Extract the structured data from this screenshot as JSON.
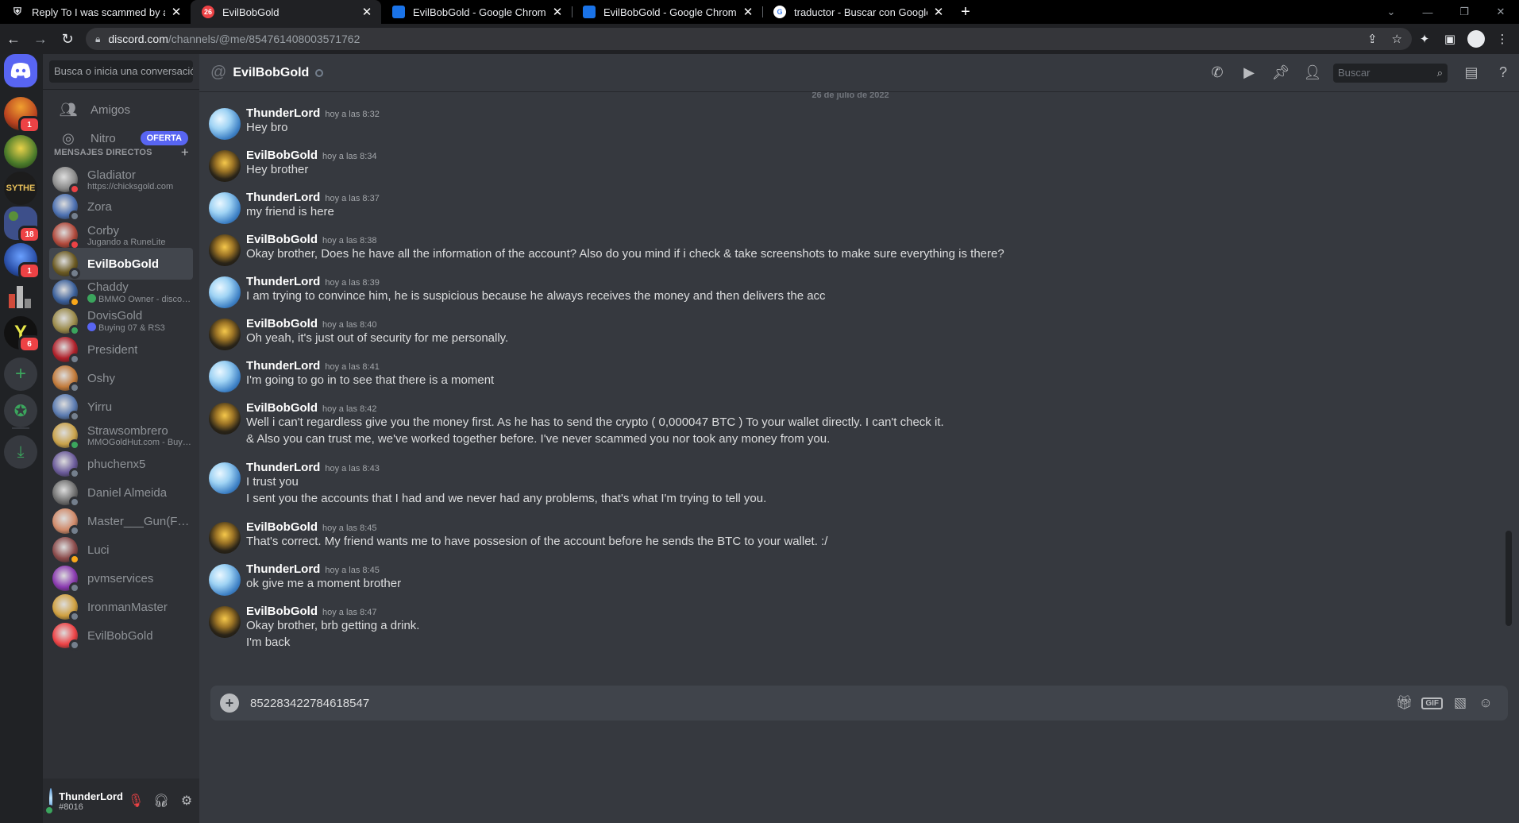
{
  "browser": {
    "tabs": [
      {
        "title": "Reply To I was scammed by a bg",
        "icon": "shield-icon",
        "active": false
      },
      {
        "title": "EvilBobGold",
        "icon": "discord-icon",
        "badge": "26",
        "active": true
      },
      {
        "title": "EvilBobGold - Google Chrome",
        "icon": "blue-app-icon",
        "active": false
      },
      {
        "title": "EvilBobGold - Google Chrome",
        "icon": "blue-app-icon",
        "active": false
      },
      {
        "title": "traductor - Buscar con Google",
        "icon": "google-icon",
        "active": false
      }
    ],
    "new_tab": "+",
    "url_host": "discord.com",
    "url_path": "/channels/@me/854761408003571762"
  },
  "servers": {
    "badges": [
      "1",
      "18",
      "1",
      "6"
    ]
  },
  "sidebar": {
    "search_placeholder": "Busca o inicia una conversación",
    "nav": {
      "friends": "Amigos",
      "nitro": "Nitro",
      "nitro_badge": "OFERTA"
    },
    "dm_header": "MENSAJES DIRECTOS",
    "dms": [
      {
        "name": "Gladiator",
        "sub": "https://chicksgold.com",
        "status": "dnd"
      },
      {
        "name": "Zora",
        "sub": "",
        "status": "offline"
      },
      {
        "name": "Corby",
        "sub": "Jugando a RuneLite",
        "status": "dnd"
      },
      {
        "name": "EvilBobGold",
        "sub": "",
        "status": "offline"
      },
      {
        "name": "Chaddy",
        "sub": "BMMO Owner - discord.gg...",
        "status": "idle"
      },
      {
        "name": "DovisGold",
        "sub": "Buying 07 & RS3",
        "status": "online"
      },
      {
        "name": "President",
        "sub": "",
        "status": "offline"
      },
      {
        "name": "Oshy",
        "sub": "",
        "status": "offline"
      },
      {
        "name": "Yirru",
        "sub": "",
        "status": "offline"
      },
      {
        "name": "Strawsombrero",
        "sub": "MMOGoldHut.com - Buying/S...",
        "status": "online"
      },
      {
        "name": "phuchenx5",
        "sub": "",
        "status": "offline"
      },
      {
        "name": "Daniel Almeida",
        "sub": "",
        "status": "offline"
      },
      {
        "name": "Master___Gun(FML)",
        "sub": "",
        "status": "offline"
      },
      {
        "name": "Luci",
        "sub": "",
        "status": "idle"
      },
      {
        "name": "pvmservices",
        "sub": "",
        "status": "offline"
      },
      {
        "name": "IronmanMaster",
        "sub": "",
        "status": "offline"
      },
      {
        "name": "EvilBobGold",
        "sub": "",
        "status": "offline"
      }
    ],
    "user": {
      "name": "ThunderLord",
      "tag": "#8016"
    }
  },
  "chat": {
    "channel_name": "EvilBobGold",
    "search_placeholder": "Buscar",
    "date_divider": "26 de julio de 2022",
    "messages": [
      {
        "author": "ThunderLord",
        "time": "hoy a las 8:32",
        "lines": [
          "Hey bro"
        ]
      },
      {
        "author": "EvilBobGold",
        "time": "hoy a las 8:34",
        "lines": [
          "Hey brother"
        ]
      },
      {
        "author": "ThunderLord",
        "time": "hoy a las 8:37",
        "lines": [
          "my friend is here"
        ]
      },
      {
        "author": "EvilBobGold",
        "time": "hoy a las 8:38",
        "lines": [
          "Okay brother, Does he have all the information of the account? Also do you mind if i check & take screenshots to make sure everything is there?"
        ]
      },
      {
        "author": "ThunderLord",
        "time": "hoy a las 8:39",
        "lines": [
          "I am trying to convince him, he is suspicious because he always receives the money and then delivers the acc"
        ]
      },
      {
        "author": "EvilBobGold",
        "time": "hoy a las 8:40",
        "lines": [
          "Oh yeah, it's just out of security for me personally."
        ]
      },
      {
        "author": "ThunderLord",
        "time": "hoy a las 8:41",
        "lines": [
          "I'm going to go in to see that there is a moment"
        ]
      },
      {
        "author": "EvilBobGold",
        "time": "hoy a las 8:42",
        "lines": [
          "Well i can't regardless give you the money first. As he has to send the crypto ( 0,000047 BTC ) To your wallet directly. I can't check it.",
          "& Also you can trust me, we've worked together before. I've never scammed you nor took any money from you."
        ]
      },
      {
        "author": "ThunderLord",
        "time": "hoy a las 8:43",
        "lines": [
          "I trust you",
          "I sent you the accounts that I had and we never had any problems, that's what I'm trying to tell you."
        ]
      },
      {
        "author": "EvilBobGold",
        "time": "hoy a las 8:45",
        "lines": [
          "That's correct. My friend wants me to have possesion of the account before he sends the BTC to your wallet. :/"
        ]
      },
      {
        "author": "ThunderLord",
        "time": "hoy a las 8:45",
        "lines": [
          "ok give me a moment brother"
        ]
      },
      {
        "author": "EvilBobGold",
        "time": "hoy a las 8:47",
        "lines": [
          "Okay brother, brb getting a drink.",
          "I'm back"
        ]
      }
    ],
    "composer_value": "852283422784618547",
    "composer_gif": "GIF"
  },
  "colors": {
    "blurple": "#5865f2",
    "online": "#3ba55d",
    "dnd": "#ed4245",
    "idle": "#faa81a",
    "offline": "#747f8d"
  }
}
